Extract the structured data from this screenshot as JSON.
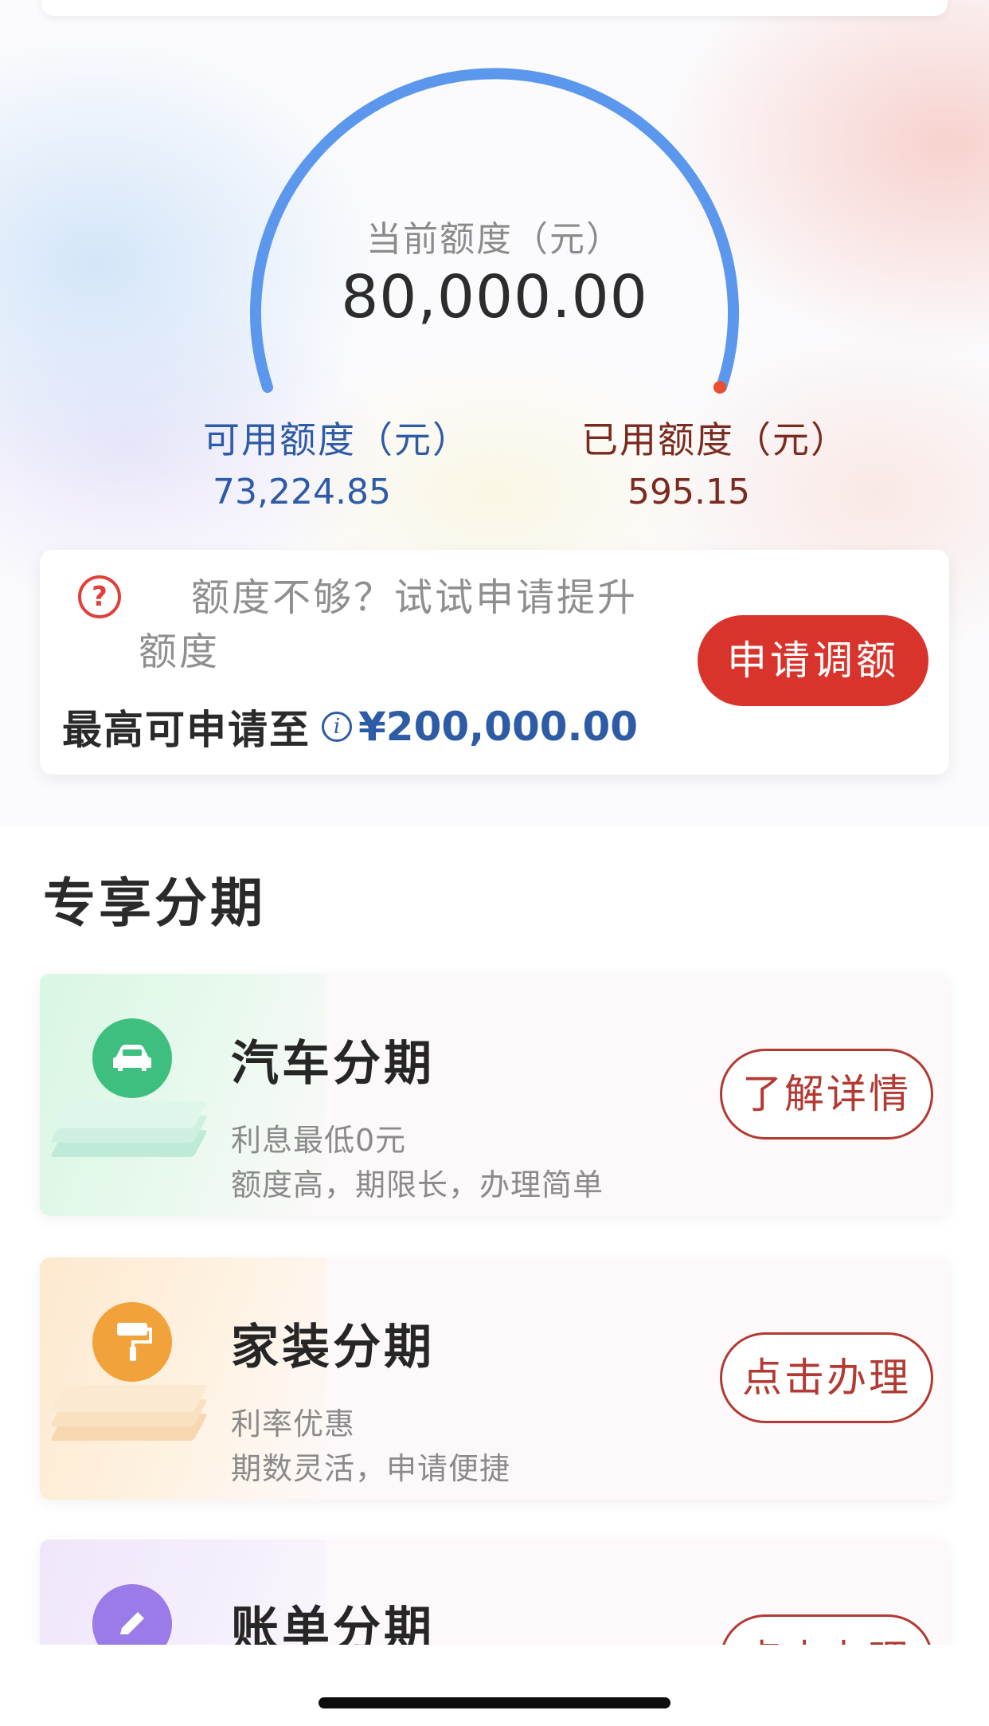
{
  "credit": {
    "title": "当前额度（元）",
    "total": "80,000.00",
    "available_label": "可用额度（元）",
    "available_value": "73,224.85",
    "used_label": "已用额度（元）",
    "used_value": "595.15",
    "used_fraction": 0.0074,
    "colors": {
      "arc": "#5b97ec",
      "used": "#e8502e"
    }
  },
  "raise": {
    "hint": "额度不够？试试申请提升额度",
    "max_label": "最高可申请至",
    "max_value": "¥200,000.00",
    "button": "申请调额",
    "icons": {
      "hint": "question-circle-icon",
      "info": "info-icon"
    }
  },
  "section": {
    "title": "专享分期"
  },
  "products": [
    {
      "name": "汽车分期",
      "sub1": "利息最低0元",
      "sub2": "额度高，期限长，办理简单",
      "button": "了解详情",
      "icon": "car-icon",
      "color": "#3fbf7f"
    },
    {
      "name": "家装分期",
      "sub1": "利率优惠",
      "sub2": "期数灵活，申请便捷",
      "button": "点击办理",
      "icon": "paint-roller-icon",
      "color": "#f2a23a"
    },
    {
      "name": "账单分期",
      "button": "点击办理",
      "icon": "pencil-icon",
      "color": "#9b7be8"
    }
  ]
}
